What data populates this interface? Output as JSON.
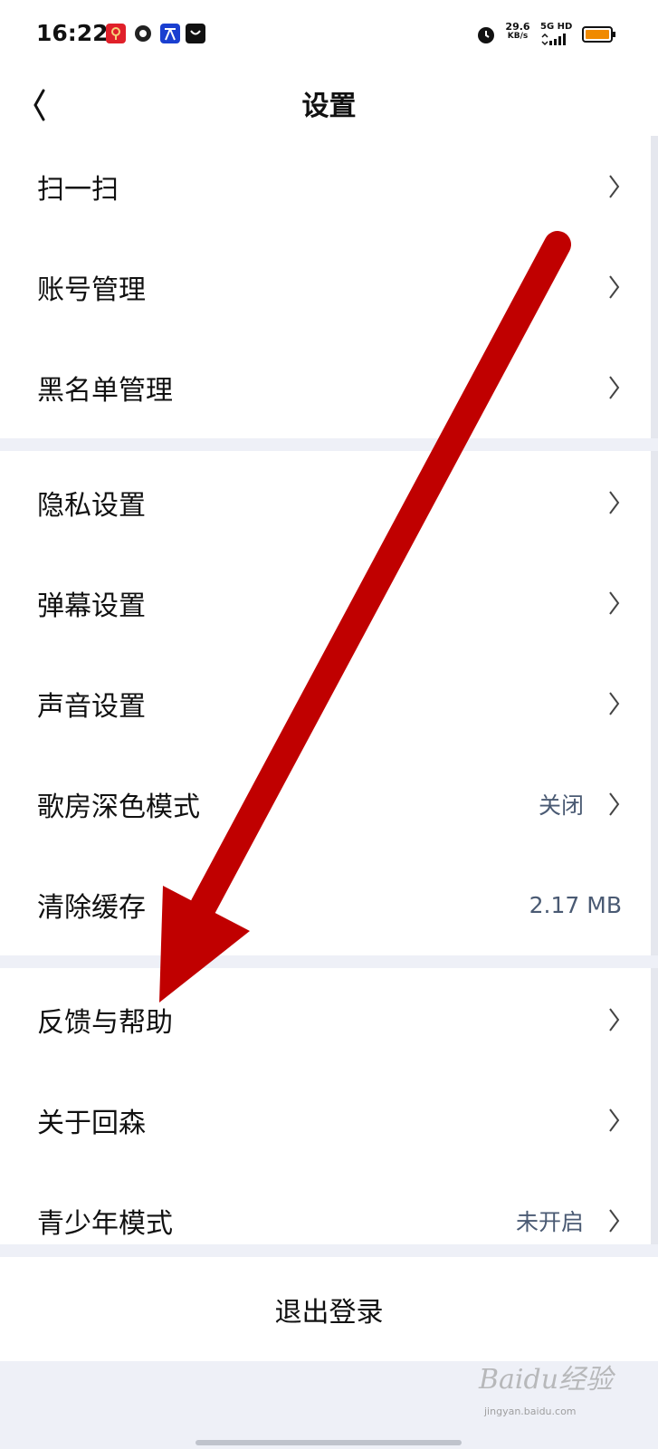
{
  "status_bar": {
    "time": "16:22",
    "net_speed": "29.6",
    "net_unit": "KB/s",
    "network_type": "5G HD",
    "notification_icons": [
      "red-envelope-icon",
      "ball-icon",
      "translate-icon",
      "bag-icon"
    ],
    "status_icons": [
      "alarm-icon",
      "signal-icon",
      "battery-icon"
    ]
  },
  "nav": {
    "title": "设置"
  },
  "groups": [
    {
      "items": [
        {
          "label": "扫一扫",
          "value": "",
          "chevron": true
        },
        {
          "label": "账号管理",
          "value": "",
          "chevron": true
        },
        {
          "label": "黑名单管理",
          "value": "",
          "chevron": true
        }
      ]
    },
    {
      "items": [
        {
          "label": "隐私设置",
          "value": "",
          "chevron": true
        },
        {
          "label": "弹幕设置",
          "value": "",
          "chevron": true
        },
        {
          "label": "声音设置",
          "value": "",
          "chevron": true
        },
        {
          "label": "歌房深色模式",
          "value": "关闭",
          "chevron": true
        },
        {
          "label": "清除缓存",
          "value": "2.17 MB",
          "chevron": false
        }
      ]
    },
    {
      "items": [
        {
          "label": "反馈与帮助",
          "value": "",
          "chevron": true
        },
        {
          "label": "关于回森",
          "value": "",
          "chevron": true
        },
        {
          "label": "青少年模式",
          "value": "未开启",
          "chevron": true
        }
      ]
    }
  ],
  "logout_label": "退出登录",
  "watermark": {
    "text": "Baidu经验",
    "sub": "jingyan.baidu.com"
  },
  "colors": {
    "background": "#ffffff",
    "section_gap": "#eef0f7",
    "value_text": "#4a5a73",
    "annotation_arrow": "#c00000"
  }
}
